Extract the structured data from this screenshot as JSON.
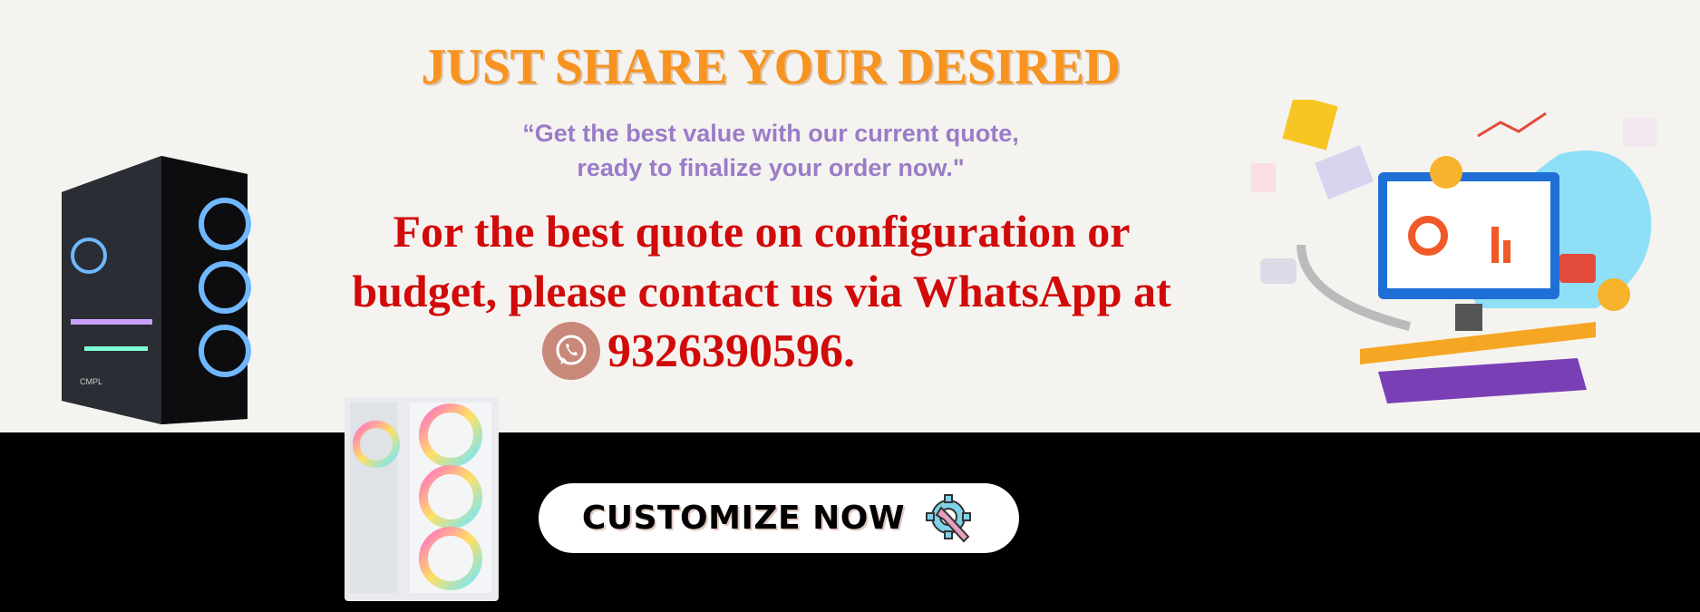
{
  "banner": {
    "title": "JUST SHARE YOUR DESIRED",
    "quote_line1": "“Get the best value with our current quote,",
    "quote_line2": "ready to finalize your order now.\"",
    "main_line1": "For the best quote on configuration or",
    "main_line2": "budget, please contact us via WhatsApp at",
    "phone": "9326390596.",
    "cta_label": "CUSTOMIZE NOW",
    "pc_brand": "CMPL"
  },
  "colors": {
    "background": "#f5f3ef",
    "title": "#f7931e",
    "quote": "#9a7cc8",
    "main_text": "#d10a0a",
    "band": "#000000",
    "whatsapp_badge": "#c8897a"
  }
}
